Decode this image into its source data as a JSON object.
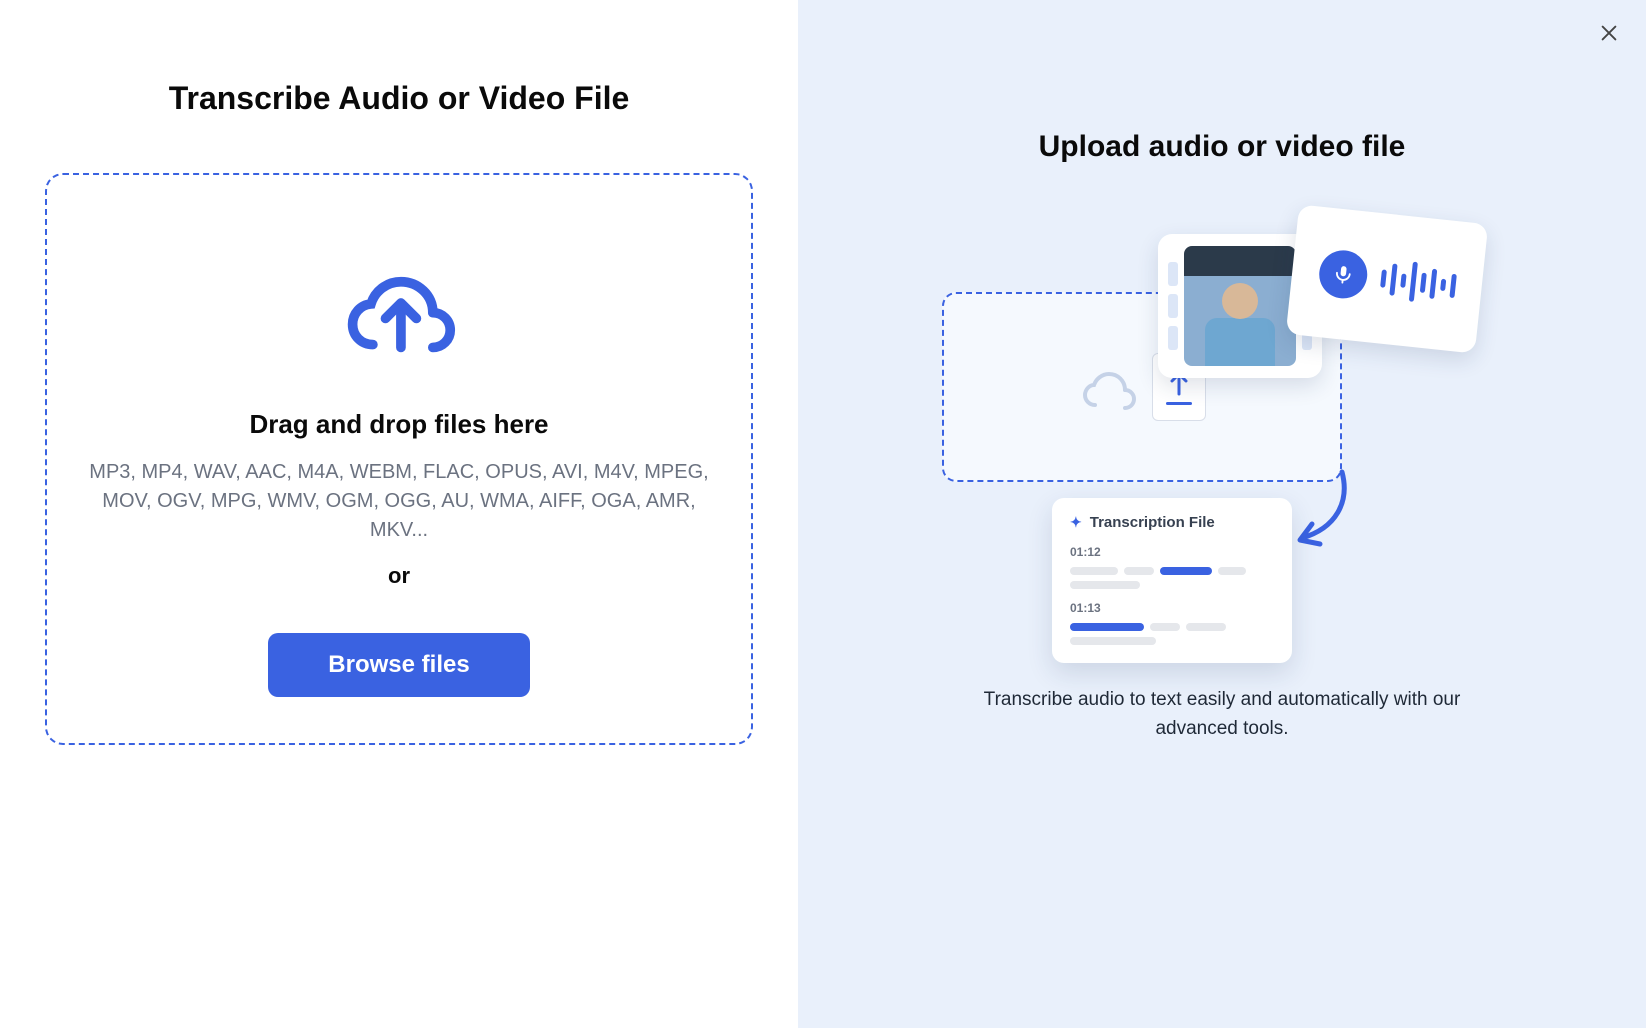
{
  "left": {
    "title": "Transcribe Audio or Video File",
    "dropzone": {
      "heading": "Drag and drop files here",
      "formats": "MP3, MP4, WAV, AAC, M4A, WEBM, FLAC, OPUS, AVI, M4V, MPEG, MOV, OGV, MPG, WMV, OGM, OGG, AU, WMA, AIFF, OGA, AMR, MKV...",
      "or": "or",
      "browse_label": "Browse files"
    }
  },
  "right": {
    "title": "Upload audio or video file",
    "description": "Transcribe audio to text easily and automatically with our advanced tools.",
    "illustration": {
      "transcription_card_title": "Transcription File",
      "timestamp_1": "01:12",
      "timestamp_2": "01:13"
    }
  }
}
